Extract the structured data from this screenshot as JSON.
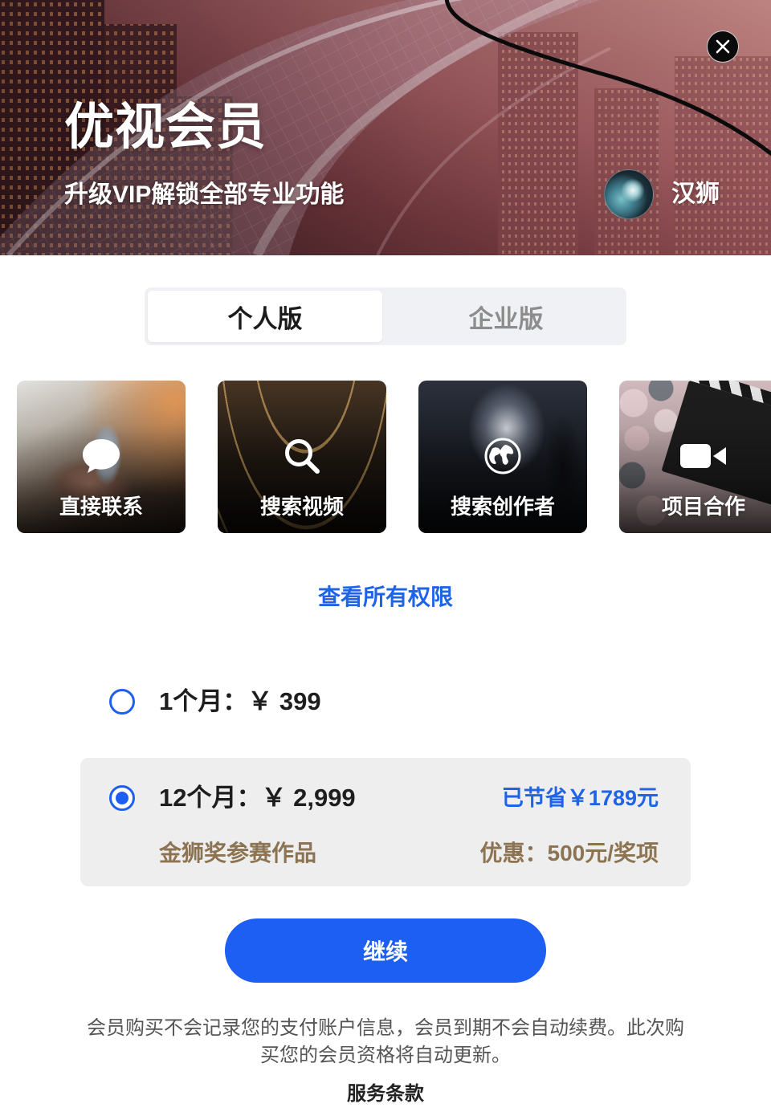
{
  "header": {
    "title": "优视会员",
    "subtitle": "升级VIP解锁全部专业功能",
    "user": {
      "name": "汉狮"
    },
    "close_icon": "close-icon"
  },
  "tabs": [
    {
      "label": "个人版",
      "selected": true
    },
    {
      "label": "企业版",
      "selected": false
    }
  ],
  "features": [
    {
      "label": "直接联系",
      "icon": "chat-bubble-icon"
    },
    {
      "label": "搜索视频",
      "icon": "search-icon"
    },
    {
      "label": "搜索创作者",
      "icon": "globe-icon"
    },
    {
      "label": "项目合作",
      "icon": "video-camera-icon"
    }
  ],
  "view_all_link": "查看所有权限",
  "plans": [
    {
      "label": "1个月：￥ 399",
      "selected": false
    },
    {
      "label": "12个月：￥ 2,999",
      "selected": true,
      "savings": "已节省￥1789元",
      "promo_title": "金狮奖参赛作品",
      "promo_value": "优惠：500元/奖项"
    }
  ],
  "continue_button": "继续",
  "disclaimer": "会员购买不会记录您的支付账户信息，会员到期不会自动续费。此次购买您的会员资格将自动更新。",
  "terms_link": "服务条款",
  "colors": {
    "accent": "#1d5ff2",
    "link": "#1f63e6",
    "promo": "#8c7352",
    "tab_inactive": "#8d8d8d",
    "plan_highlight_bg": "#eeeeee"
  }
}
